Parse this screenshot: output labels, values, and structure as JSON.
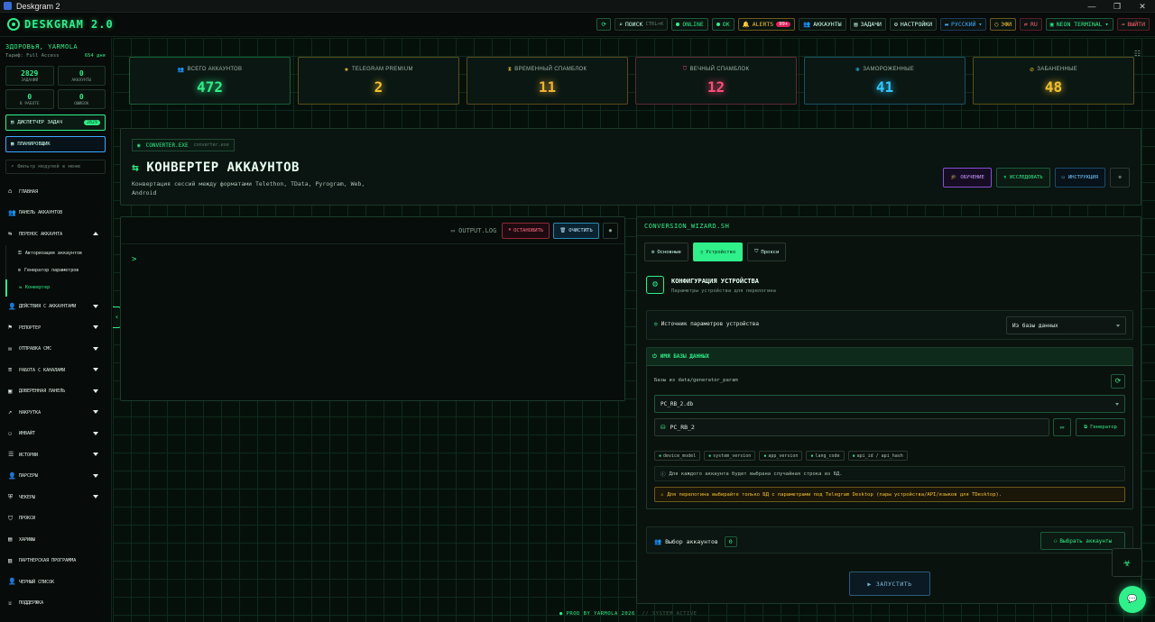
{
  "window": {
    "title": "Deskgram 2",
    "min": "—",
    "max": "❐",
    "close": "✕"
  },
  "topbar": {
    "logo": "DESKGRAM 2.0",
    "search": "ПОИСК",
    "search_kbd": "CTRL+K",
    "online": "ONLINE",
    "ok": "OK",
    "alerts": "ALERTS",
    "alerts_count": "99+",
    "accounts": "АККАУНТЫ",
    "tasks": "ЗАДАЧИ",
    "settings": "НАСТРОЙКИ",
    "lang": "РУССКИЙ",
    "theme": "ЭФИ",
    "ru": "RU",
    "terminal": "NEON TERMINAL",
    "logout": "ВЫЙТИ"
  },
  "sidebar": {
    "user": "ЗДОРОВЬЯ, YARMOLA",
    "plan_label": "Тариф: Full Access",
    "plan_days": "654 дня",
    "stats": [
      {
        "value": "2829",
        "label": "ЗАДАНИЙ"
      },
      {
        "value": "0",
        "label": "АККАУНТЫ"
      },
      {
        "value": "0",
        "label": "В РАБОТЕ"
      },
      {
        "value": "0",
        "label": "ОШИБОК"
      }
    ],
    "dispatcher": "ДИСПЕТЧЕР ЗАДАЧ",
    "dispatcher_count": "2829",
    "scheduler": "ПЛАНИРОВЩИК",
    "search_placeholder": "Фильтр модулей в меню",
    "nav": [
      "ГЛАВНАЯ",
      "ПАНЕЛЬ АККАУНТОВ",
      "ПЕРЕНОС АККАУНТА"
    ],
    "sub": [
      "Авторизация аккаунтов",
      "Генератор параметров",
      "Конвертер"
    ],
    "nav2": [
      "ДЕЙСТВИЯ С АККАУНТАМИ",
      "РЕПОРТЕР",
      "ОТПРАВКА СМС",
      "РАБОТА С КАНАЛАМИ",
      "ДОВЕРЕННАЯ ПАНЕЛЬ",
      "НАКРУТКА",
      "ИНВАЙТ",
      "ИСТОРИИ",
      "ПАРСЕРЫ",
      "ЧЕКЕРЫ",
      "ПРОКСИ",
      "ХАРИФЫ",
      "ПАРТНЕРСКАЯ ПРОГРАММА",
      "ЧЕРНЫЙ СПИСОК",
      "ПОДДЕРЖКА"
    ]
  },
  "cards": [
    {
      "label": "ВСЕГО АККАУНТОВ",
      "value": "472",
      "color": "#2ff08a",
      "icon": "users-icon"
    },
    {
      "label": "TELEGRAM PREMIUM",
      "value": "2",
      "color": "#f2c230",
      "icon": "star-icon"
    },
    {
      "label": "ВРЕМЕННЫЙ СПАМБЛОК",
      "value": "11",
      "color": "#f2b230",
      "icon": "hourglass-icon"
    },
    {
      "label": "ВЕЧНЫЙ СПАМБЛОК",
      "value": "12",
      "color": "#ff4d7a",
      "icon": "shield-icon"
    },
    {
      "label": "ЗАМОРОЖЕННЫЕ",
      "value": "41",
      "color": "#33c7ff",
      "icon": "snowflake-icon"
    },
    {
      "label": "ЗАБАНЕННЫЕ",
      "value": "48",
      "color": "#f2c230",
      "icon": "ban-icon"
    }
  ],
  "header": {
    "exe": "CONVERTER.EXE",
    "exe_sub": "converter.exe",
    "title": "КОНВЕРТЕР АККАУНТОВ",
    "desc": "Конвертация сессий между форматами Telethon, TData, Pyrogram, Web, Android",
    "btn_learn": "ОБУЧЕНИЕ",
    "btn_research": "ИССЛЕДОВАТЬ",
    "btn_instr": "ИНСТРУКЦИЯ"
  },
  "terminal": {
    "label": "OUTPUT.LOG",
    "stop": "ОСТАНОВИТЬ",
    "clear": "ОЧИСТИТЬ",
    "prompt": ">"
  },
  "wizard": {
    "title": "CONVERSION_WIZARD.SH",
    "tabs": [
      "Основные",
      "Устройство",
      "Прокси"
    ],
    "cfg_title": "КОНФИГУРАЦИЯ УСТРОЙСТВА",
    "cfg_sub": "Параметры устройства для перелогина",
    "src_label": "Источник параметров устройства",
    "src_value": "Из базы данных",
    "db_title": "ИМЯ БАЗЫ ДАННЫХ",
    "db_hint": "Базы из data/generator_param",
    "db_select": "PC_RB_2.db",
    "db_name": "PC_RB_2",
    "generator": "Генератор",
    "tags": [
      "device_model",
      "system_version",
      "app_version",
      "lang_code",
      "api_id / api_hash"
    ],
    "info1": "Для каждого аккаунта будет выбрана случайная строка из БД.",
    "info2": "Для перелогина выбирайте только БД с параметрами под Telegram Desktop (пары устройства/API/языков для TDesktop).",
    "acc_label": "Выбор аккаунтов",
    "acc_count": "0",
    "acc_btn": "Выбрать аккаунты",
    "run": "ЗАПУСТИТЬ"
  },
  "footer": {
    "left": "● PROD BY YARMOLA 2026",
    "right": "// SYSTEM ACTIVE"
  }
}
